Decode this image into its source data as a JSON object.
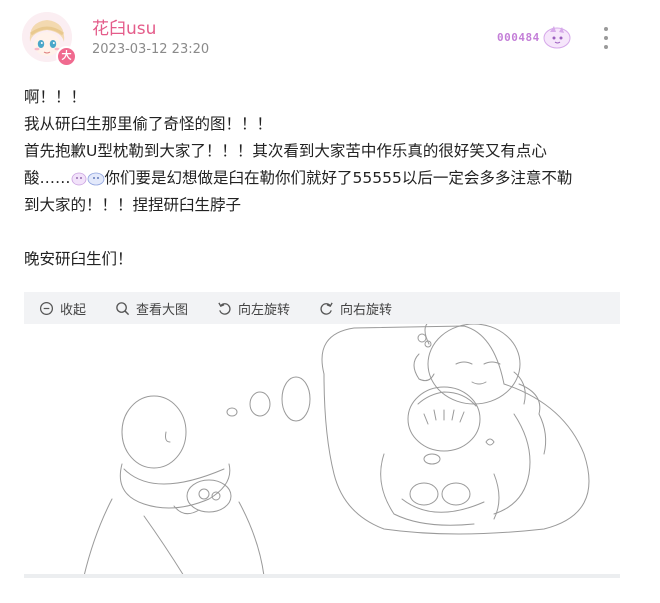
{
  "user": {
    "name": "花臼usu",
    "timestamp": "2023-03-12 23:20",
    "badge_text": "大",
    "fan_badge_number": "000484"
  },
  "post": {
    "lines": [
      "啊！！！",
      "我从研臼生那里偷了奇怪的图！！！",
      "首先抱歉U型枕勒到大家了！！！其次看到大家苦中作乐真的很好笑又有点心",
      "酸……",
      "你们要是幻想做是臼在勒你们就好了55555以后一定会多多注意不勒",
      "到大家的！！！捏捏研臼生脖子",
      "晚安研臼生们！"
    ]
  },
  "image_toolbar": {
    "collapse": "收起",
    "view_large": "查看大图",
    "rotate_left": "向左旋转",
    "rotate_right": "向右旋转"
  },
  "icons": {
    "collapse": "collapse-circle-icon",
    "view_large": "magnifier-icon",
    "rotate_left": "rotate-left-icon",
    "rotate_right": "rotate-right-icon",
    "more": "more-vertical-icon"
  },
  "colors": {
    "username": "#e45c8a",
    "timestamp": "#8a8a8a",
    "toolbar_bg": "#f2f3f5",
    "fan_badge": "#c47fd8"
  }
}
